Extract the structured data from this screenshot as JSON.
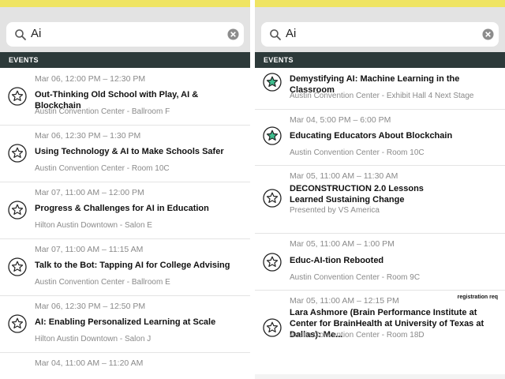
{
  "search": {
    "query": "Ai"
  },
  "section_label": "EVENTS",
  "left_events": [
    {
      "time": "Mar 06, 12:00 PM – 12:30 PM",
      "title": "Out-Thinking Old School with Play, AI & Blockchain",
      "location": "Austin Convention Center - Ballroom F",
      "starred": false
    },
    {
      "time": "Mar 06, 12:30 PM – 1:30 PM",
      "title": "Using Technology & AI to Make Schools Safer",
      "location": "Austin Convention Center - Room 10C",
      "starred": false
    },
    {
      "time": "Mar 07, 11:00 AM – 12:00 PM",
      "title": "Progress & Challenges for AI in Education",
      "location": "Hilton Austin Downtown - Salon E",
      "starred": false
    },
    {
      "time": "Mar 07, 11:00 AM – 11:15 AM",
      "title": "Talk to the Bot: Tapping AI for College Advising",
      "location": "Austin Convention Center - Ballroom E",
      "starred": false
    },
    {
      "time": "Mar 06, 12:30 PM – 12:50 PM",
      "title": "AI: Enabling Personalized Learning at Scale",
      "location": "Hilton Austin Downtown - Salon J",
      "starred": false
    },
    {
      "time": "Mar 04, 11:00 AM – 11:20 AM",
      "title": "",
      "location": "",
      "starred": false
    }
  ],
  "right_events": [
    {
      "time": "",
      "title": "Demystifying AI: Machine Learning in the Classroom",
      "location": "Austin Convention Center - Exhibit Hall 4 Next Stage",
      "starred": true
    },
    {
      "time": "Mar 04, 5:00 PM – 6:00 PM",
      "title": "Educating Educators About Blockchain",
      "location": "Austin Convention Center - Room 10C",
      "starred": true
    },
    {
      "time": "Mar 05, 11:00 AM – 11:30 AM",
      "title": "DECONSTRUCTION 2.0 Lessons Learned Sustaining Change",
      "location": "Presented by VS America",
      "starred": false
    },
    {
      "time": "Mar 05, 11:00 AM – 1:00 PM",
      "title": "Educ-AI-tion Rebooted",
      "location": "Austin Convention Center - Room 9C",
      "starred": false
    },
    {
      "time": "Mar 05, 11:00 AM – 12:15 PM",
      "title": "Lara Ashmore (Brain Performance Institute at Center for BrainHealth at University of Texas at Dallas): Me...",
      "location": "Austin Convention Center - Room 18D",
      "starred": false,
      "badge": "registration req"
    }
  ],
  "colors": {
    "accent_yellow": "#efe463",
    "section_bg": "#2d3a3a",
    "star_fill": "#3fbf8f"
  }
}
